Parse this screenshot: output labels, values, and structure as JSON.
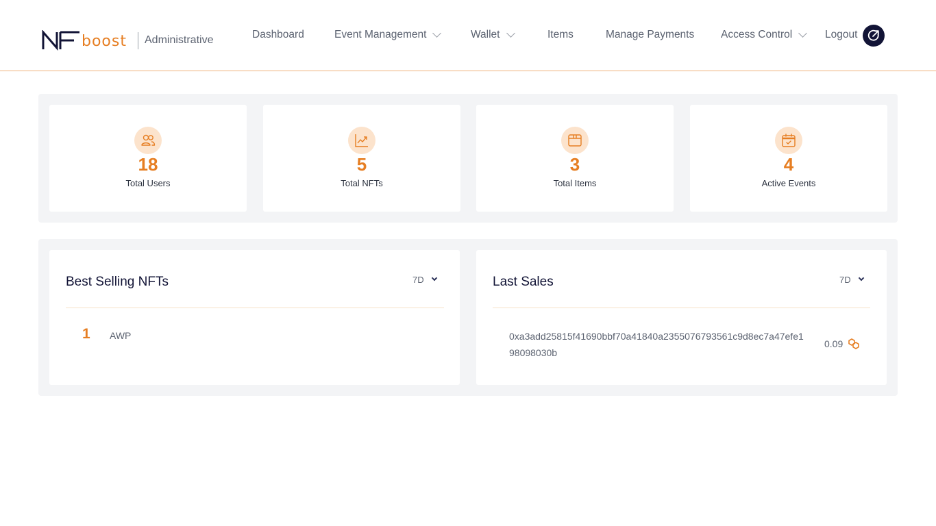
{
  "brand": {
    "logo_text": "NFboost",
    "section": "Administrative"
  },
  "nav": {
    "dashboard": "Dashboard",
    "event_management": "Event Management",
    "wallet": "Wallet",
    "items": "Items",
    "manage_payments": "Manage Payments",
    "access_control": "Access Control",
    "logout": "Logout"
  },
  "stats": [
    {
      "value": "18",
      "label": "Total Users",
      "icon": "users-icon"
    },
    {
      "value": "5",
      "label": "Total NFTs",
      "icon": "trend-chart-icon"
    },
    {
      "value": "3",
      "label": "Total Items",
      "icon": "box-icon"
    },
    {
      "value": "4",
      "label": "Active Events",
      "icon": "calendar-check-icon"
    }
  ],
  "best_selling": {
    "title": "Best Selling NFTs",
    "period": "7D",
    "rows": [
      {
        "rank": "1",
        "name": "AWP"
      }
    ]
  },
  "last_sales": {
    "title": "Last Sales",
    "period": "7D",
    "rows": [
      {
        "hash": "0xa3add25815f41690bbf70a41840a2355076793561c9d8ec7a47efe198098030b",
        "amount": "0.09",
        "icon": "chain-link-icon"
      }
    ]
  },
  "colors": {
    "accent": "#e67e22",
    "navy": "#121436",
    "panel_bg": "#f3f4f6",
    "icon_bg": "#fce3cc"
  }
}
